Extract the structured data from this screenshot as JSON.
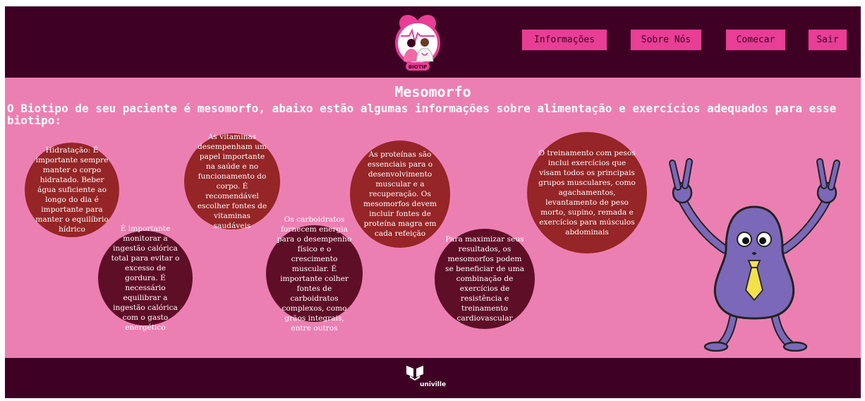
{
  "header": {
    "logo_text": "BIOTIP",
    "nav": [
      "Informações",
      "Sobre Nós",
      "Comecar",
      "Sair"
    ]
  },
  "main": {
    "title": "Mesomorfo",
    "intro": "O Biotipo de seu paciente é mesomorfo, abaixo estão algumas informações sobre alimentação e exercícios adequados para esse biotipo:",
    "bubbles": [
      "Hidratação: É importante sempre manter o corpo hidratado. Beber água suficiente ao longo do dia é importante para manter o equilíbrio hídrico",
      "É importante monitorar a ingestão calórica total para evitar o excesso de gordura. É necessário equilibrar a ingestão calórica com o gasto energético",
      "As vitaminas desempenham um papel importante na saúde e no funcionamento do corpo. É recomendável escolher fontes de vitaminas saudáveis",
      "Os carboidratos fornecem energia para o desempenho físico e o crescimento muscular. É importante colher fontes de carboidratos complexos, como grãos integrais, entre outros",
      "As proteínas são essenciais para o desenvolvimento muscular e a recuperação. Os mesomorfos devem incluir fontes de proteína magra em cada refeição",
      "Para maximizar seus resultados, os mesomorfos podem se beneficiar de uma combinação de exercícios de resistência e treinamento cardiovascular",
      "O treinamento com pesos inclui exercícios que visam todos os principais grupos musculares, como agachamentos, levantamento de peso morto, supino, remada e exercícios para músculos abdominais"
    ]
  },
  "footer": {
    "brand": "univille"
  },
  "colors": {
    "header_bg": "#3e0124",
    "main_bg": "#ec7fb2",
    "button_bg": "#e83e95",
    "bubble_red": "#952526",
    "bubble_dark": "#5f0e27",
    "mascot": "#7b68b8"
  }
}
